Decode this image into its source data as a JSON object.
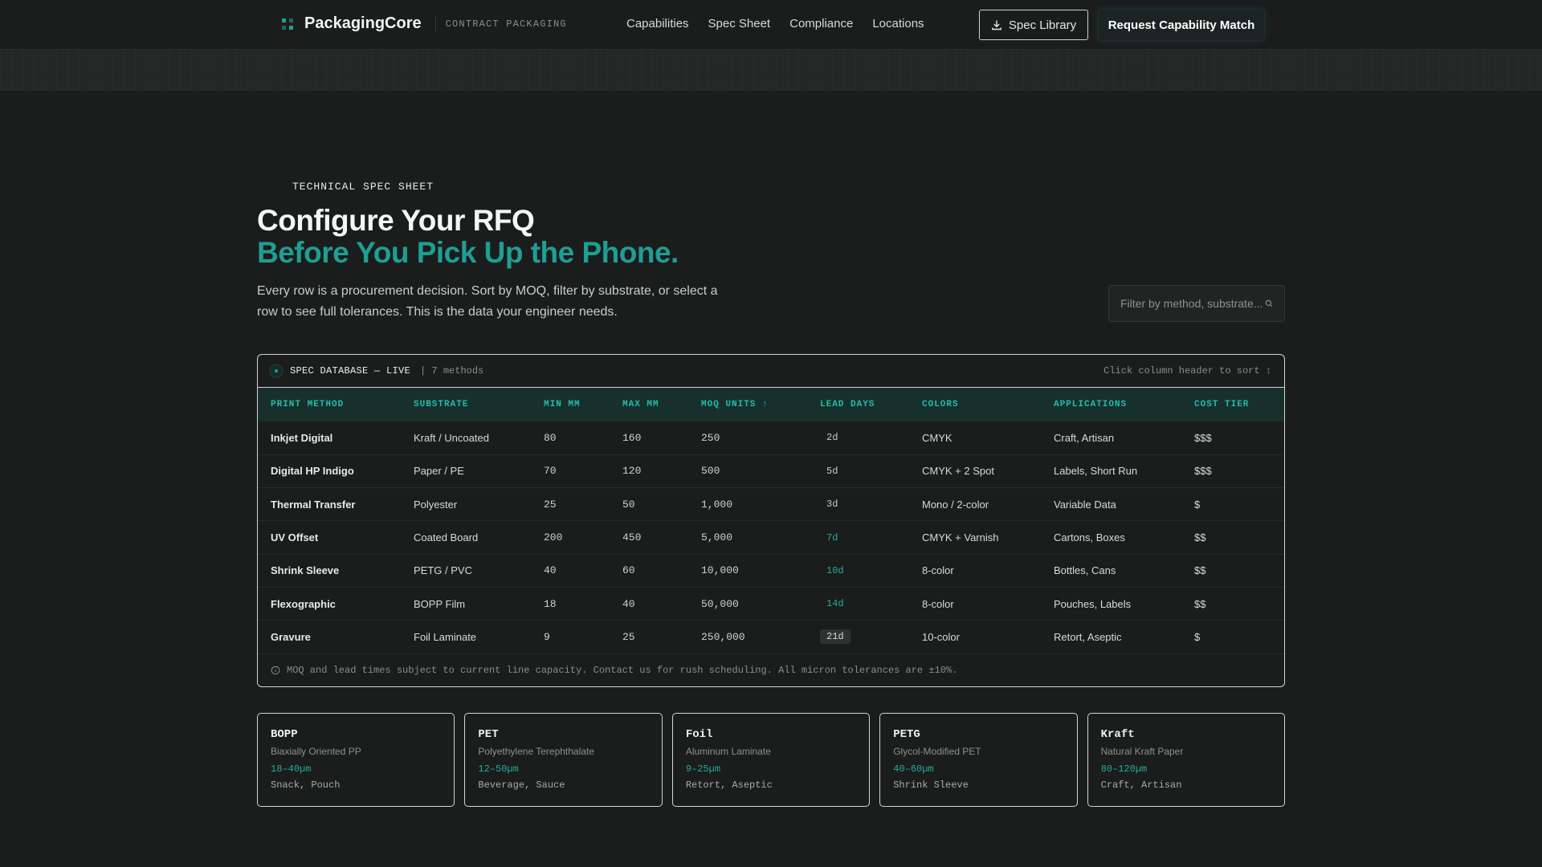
{
  "header": {
    "brand": "PackagingCore",
    "tagline": "CONTRACT PACKAGING",
    "nav": [
      "Capabilities",
      "Spec Sheet",
      "Compliance",
      "Locations"
    ],
    "spec_library_label": "Spec Library",
    "cta_label": "Request Capability Match"
  },
  "hero": {
    "eyebrow": "TECHNICAL SPEC SHEET",
    "title_line1": "Configure Your RFQ",
    "title_line2": "Before You Pick Up the Phone.",
    "description": "Every row is a procurement decision. Sort by MOQ, filter by substrate, or select a row to see full tolerances. This is the data your engineer needs.",
    "search_placeholder": "Filter by method, substrate..."
  },
  "table": {
    "title": "SPEC DATABASE — LIVE",
    "count": "| 7 methods",
    "sort_hint": "Click column header to sort ↕",
    "columns": [
      "PRINT METHOD",
      "SUBSTRATE",
      "MIN MM",
      "MAX MM",
      "MOQ UNITS ↑",
      "LEAD DAYS",
      "COLORS",
      "APPLICATIONS",
      "COST TIER"
    ],
    "rows": [
      {
        "method": "Inkjet Digital",
        "substrate": "Kraft / Uncoated",
        "min": "80",
        "max": "160",
        "moq": "250",
        "lead": "2d",
        "lead_level": "fast",
        "colors": "CMYK",
        "applications": "Craft, Artisan",
        "cost": "$$$"
      },
      {
        "method": "Digital HP Indigo",
        "substrate": "Paper / PE",
        "min": "70",
        "max": "120",
        "moq": "500",
        "lead": "5d",
        "lead_level": "fast",
        "colors": "CMYK + 2 Spot",
        "applications": "Labels, Short Run",
        "cost": "$$$"
      },
      {
        "method": "Thermal Transfer",
        "substrate": "Polyester",
        "min": "25",
        "max": "50",
        "moq": "1,000",
        "lead": "3d",
        "lead_level": "fast",
        "colors": "Mono / 2-color",
        "applications": "Variable Data",
        "cost": "$"
      },
      {
        "method": "UV Offset",
        "substrate": "Coated Board",
        "min": "200",
        "max": "450",
        "moq": "5,000",
        "lead": "7d",
        "lead_level": "mid",
        "colors": "CMYK + Varnish",
        "applications": "Cartons, Boxes",
        "cost": "$$"
      },
      {
        "method": "Shrink Sleeve",
        "substrate": "PETG / PVC",
        "min": "40",
        "max": "60",
        "moq": "10,000",
        "lead": "10d",
        "lead_level": "mid",
        "colors": "8-color",
        "applications": "Bottles, Cans",
        "cost": "$$"
      },
      {
        "method": "Flexographic",
        "substrate": "BOPP Film",
        "min": "18",
        "max": "40",
        "moq": "50,000",
        "lead": "14d",
        "lead_level": "mid",
        "colors": "8-color",
        "applications": "Pouches, Labels",
        "cost": "$$"
      },
      {
        "method": "Gravure",
        "substrate": "Foil Laminate",
        "min": "9",
        "max": "25",
        "moq": "250,000",
        "lead": "21d",
        "lead_level": "slow",
        "colors": "10-color",
        "applications": "Retort, Aseptic",
        "cost": "$"
      }
    ],
    "footnote": "MOQ and lead times subject to current line capacity. Contact us for rush scheduling. All micron tolerances are ±10%."
  },
  "substrates": [
    {
      "code": "BOPP",
      "name": "Biaxially Oriented PP",
      "range": "18–40µm",
      "use": "Snack, Pouch"
    },
    {
      "code": "PET",
      "name": "Polyethylene Terephthalate",
      "range": "12–50µm",
      "use": "Beverage, Sauce"
    },
    {
      "code": "Foil",
      "name": "Aluminum Laminate",
      "range": "9–25µm",
      "use": "Retort, Aseptic"
    },
    {
      "code": "PETG",
      "name": "Glycol-Modified PET",
      "range": "40–60µm",
      "use": "Shrink Sleeve"
    },
    {
      "code": "Kraft",
      "name": "Natural Kraft Paper",
      "range": "80–120µm",
      "use": "Craft, Artisan"
    }
  ],
  "colors": {
    "accent": "#1f9e93",
    "accent_bright": "#1fbfae",
    "background": "#1b1c1c",
    "table_header": "#17302c"
  }
}
